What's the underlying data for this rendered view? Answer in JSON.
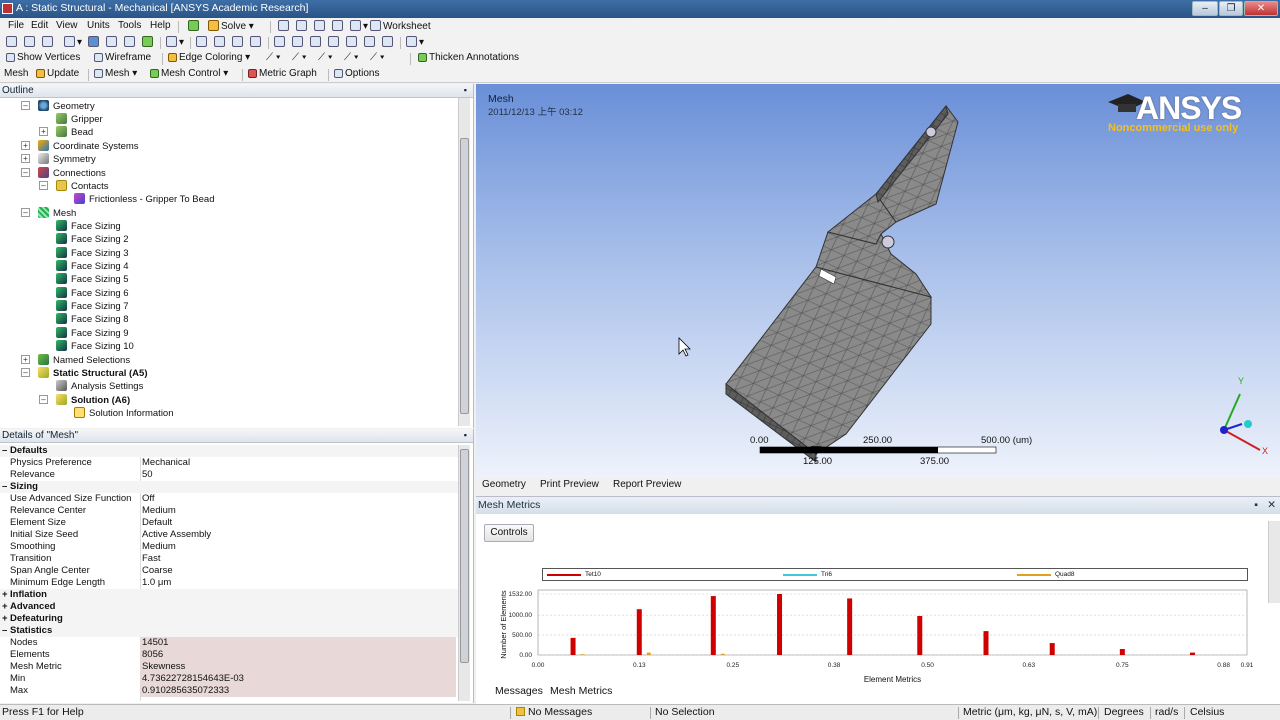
{
  "window": {
    "title": "A : Static Structural - Mechanical [ANSYS Academic Research]"
  },
  "menu": [
    "File",
    "Edit",
    "View",
    "Units",
    "Tools",
    "Help"
  ],
  "toolbar1": {
    "solve": "Solve",
    "worksheet": "Worksheet"
  },
  "toolbar3": {
    "show_vertices": "Show Vertices",
    "wireframe": "Wireframe",
    "edge_coloring": "Edge Coloring",
    "thicken": "Thicken Annotations"
  },
  "toolbar4": {
    "mesh": "Mesh",
    "update": "Update",
    "mesh_menu": "Mesh",
    "mesh_control": "Mesh Control",
    "metric_graph": "Metric Graph",
    "options": "Options"
  },
  "outline": {
    "header": "Outline",
    "items": [
      {
        "label": "Geometry",
        "icon": "geometry-icon"
      },
      {
        "label": "Gripper",
        "icon": "body-icon"
      },
      {
        "label": "Bead",
        "icon": "body-icon"
      },
      {
        "label": "Coordinate Systems",
        "icon": "coordinate-icon"
      },
      {
        "label": "Symmetry",
        "icon": "symmetry-icon"
      },
      {
        "label": "Connections",
        "icon": "connections-icon"
      },
      {
        "label": "Contacts",
        "icon": "folder-icon"
      },
      {
        "label": "Frictionless - Gripper To Bead",
        "icon": "contact-icon"
      },
      {
        "label": "Mesh",
        "icon": "mesh-icon"
      },
      {
        "label": "Face Sizing",
        "icon": "sizing-icon"
      },
      {
        "label": "Face Sizing 2",
        "icon": "sizing-icon"
      },
      {
        "label": "Face Sizing 3",
        "icon": "sizing-icon"
      },
      {
        "label": "Face Sizing 4",
        "icon": "sizing-icon"
      },
      {
        "label": "Face Sizing 5",
        "icon": "sizing-icon"
      },
      {
        "label": "Face Sizing 6",
        "icon": "sizing-icon"
      },
      {
        "label": "Face Sizing 7",
        "icon": "sizing-icon"
      },
      {
        "label": "Face Sizing 8",
        "icon": "sizing-icon"
      },
      {
        "label": "Face Sizing 9",
        "icon": "sizing-icon"
      },
      {
        "label": "Face Sizing 10",
        "icon": "sizing-icon"
      },
      {
        "label": "Named Selections",
        "icon": "named-selection-icon"
      },
      {
        "label": "Static Structural (A5)",
        "icon": "static-structural-icon"
      },
      {
        "label": "Analysis Settings",
        "icon": "analysis-settings-icon"
      },
      {
        "label": "Solution (A6)",
        "icon": "solution-icon"
      },
      {
        "label": "Solution Information",
        "icon": "info-icon"
      }
    ]
  },
  "details": {
    "header": "Details of \"Mesh\"",
    "rows": [
      {
        "k": "Defaults",
        "v": "",
        "group": true
      },
      {
        "k": "Physics Preference",
        "v": "Mechanical"
      },
      {
        "k": "Relevance",
        "v": "50"
      },
      {
        "k": "Sizing",
        "v": "",
        "group": true
      },
      {
        "k": "Use Advanced Size Function",
        "v": "Off"
      },
      {
        "k": "Relevance Center",
        "v": "Medium"
      },
      {
        "k": "Element Size",
        "v": "Default"
      },
      {
        "k": "Initial Size Seed",
        "v": "Active Assembly"
      },
      {
        "k": "Smoothing",
        "v": "Medium"
      },
      {
        "k": "Transition",
        "v": "Fast"
      },
      {
        "k": "Span Angle Center",
        "v": "Coarse"
      },
      {
        "k": "Minimum Edge Length",
        "v": "1.0 μm"
      },
      {
        "k": "Inflation",
        "v": "",
        "group": true
      },
      {
        "k": "Advanced",
        "v": "",
        "group": true
      },
      {
        "k": "Defeaturing",
        "v": "",
        "group": true
      },
      {
        "k": "Statistics",
        "v": "",
        "group": true
      },
      {
        "k": "Nodes",
        "v": "14501"
      },
      {
        "k": "Elements",
        "v": "8056"
      },
      {
        "k": "Mesh Metric",
        "v": "Skewness"
      },
      {
        "k": "Min",
        "v": "4.73622728154643E-03"
      },
      {
        "k": "Max",
        "v": "0.910285635072333"
      }
    ]
  },
  "viewport": {
    "title": "Mesh",
    "date": "2011/12/13 上午 03:12",
    "logo": "ANSYS",
    "logo_sub": "Noncommercial use only",
    "scale": {
      "t0": "0.00",
      "t1": "250.00",
      "t2": "500.00 (um)",
      "t3": "125.00",
      "t4": "375.00"
    }
  },
  "view_tabs": [
    "Geometry",
    "Print Preview",
    "Report Preview"
  ],
  "mesh_metrics": {
    "header": "Mesh Metrics",
    "controls": "Controls"
  },
  "bottom_tabs": [
    "Messages",
    "Mesh Metrics"
  ],
  "status": {
    "help": "Press F1 for Help",
    "messages": "No Messages",
    "selection": "No Selection",
    "units": "Metric (μm, kg, μN, s, V, mA)",
    "angle": "Degrees",
    "rate": "rad/s",
    "temp": "Celsius"
  },
  "chart_data": {
    "type": "bar",
    "xlabel": "Element Metrics",
    "ylabel": "Number of Elements",
    "xlim": [
      0,
      0.91
    ],
    "ylim": [
      0,
      1532
    ],
    "x_ticks": [
      "0.00",
      "0.13",
      "0.25",
      "0.38",
      "0.50",
      "0.63",
      "0.75",
      "0.88",
      "0.91"
    ],
    "y_ticks": [
      "0.00",
      "500.00",
      "1000.00",
      "1532.00"
    ],
    "series": [
      {
        "name": "Tet10",
        "color": "#d00000",
        "x": [
          0.045,
          0.13,
          0.225,
          0.31,
          0.4,
          0.49,
          0.575,
          0.66,
          0.75,
          0.84
        ],
        "values": [
          430,
          1150,
          1480,
          1532,
          1420,
          980,
          600,
          300,
          150,
          60
        ]
      },
      {
        "name": "Tri6",
        "color": "#40c8d8",
        "x": [],
        "values": []
      },
      {
        "name": "Quad8",
        "color": "#e0a020",
        "x": [
          0.045,
          0.13,
          0.225
        ],
        "values": [
          20,
          60,
          30
        ]
      }
    ]
  }
}
